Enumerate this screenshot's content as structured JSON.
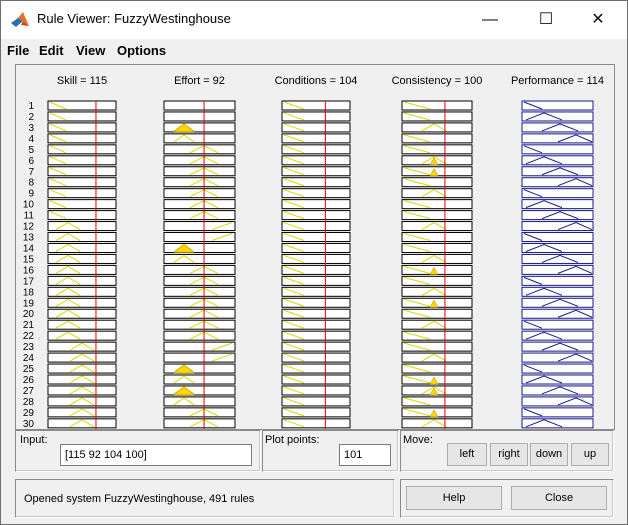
{
  "window": {
    "title": "Rule Viewer: FuzzyWestinghouse",
    "minimize": "—",
    "maximize": "☐",
    "close": "✕"
  },
  "menu": [
    "File",
    "Edit",
    "View",
    "Options"
  ],
  "inputs": [
    {
      "name": "Skill",
      "value": 115,
      "label": "Skill = 115",
      "range": [
        0,
        150
      ]
    },
    {
      "name": "Effort",
      "value": 92,
      "label": "Effort = 92",
      "range": [
        0,
        150
      ]
    },
    {
      "name": "Conditions",
      "value": 104,
      "label": "Conditions = 104",
      "range": [
        0,
        150
      ]
    },
    {
      "name": "Consistency",
      "value": 100,
      "label": "Consistency = 100",
      "range": [
        0,
        150
      ]
    }
  ],
  "output": {
    "name": "Performance",
    "value": 114,
    "label": "Performance = 114"
  },
  "rule_numbers": [
    "1",
    "2",
    "3",
    "4",
    "5",
    "6",
    "7",
    "8",
    "9",
    "10",
    "11",
    "12",
    "13",
    "14",
    "15",
    "16",
    "17",
    "18",
    "19",
    "20",
    "21",
    "22",
    "23",
    "24",
    "25",
    "26",
    "27",
    "28",
    "29",
    "30"
  ],
  "controls": {
    "input_label": "Input:",
    "input_value": "[115 92 104 100]",
    "plot_points_label": "Plot points:",
    "plot_points_value": "101",
    "move_label": "Move:",
    "left": "left",
    "right": "right",
    "down": "down",
    "up": "up",
    "help": "Help",
    "close": "Close"
  },
  "status": "Opened system FuzzyWestinghouse, 491 rules",
  "colors": {
    "line": "#d8d800",
    "fire": "#ffd700",
    "cursor": "#e00000",
    "output_mf": "#1a1a8c"
  }
}
